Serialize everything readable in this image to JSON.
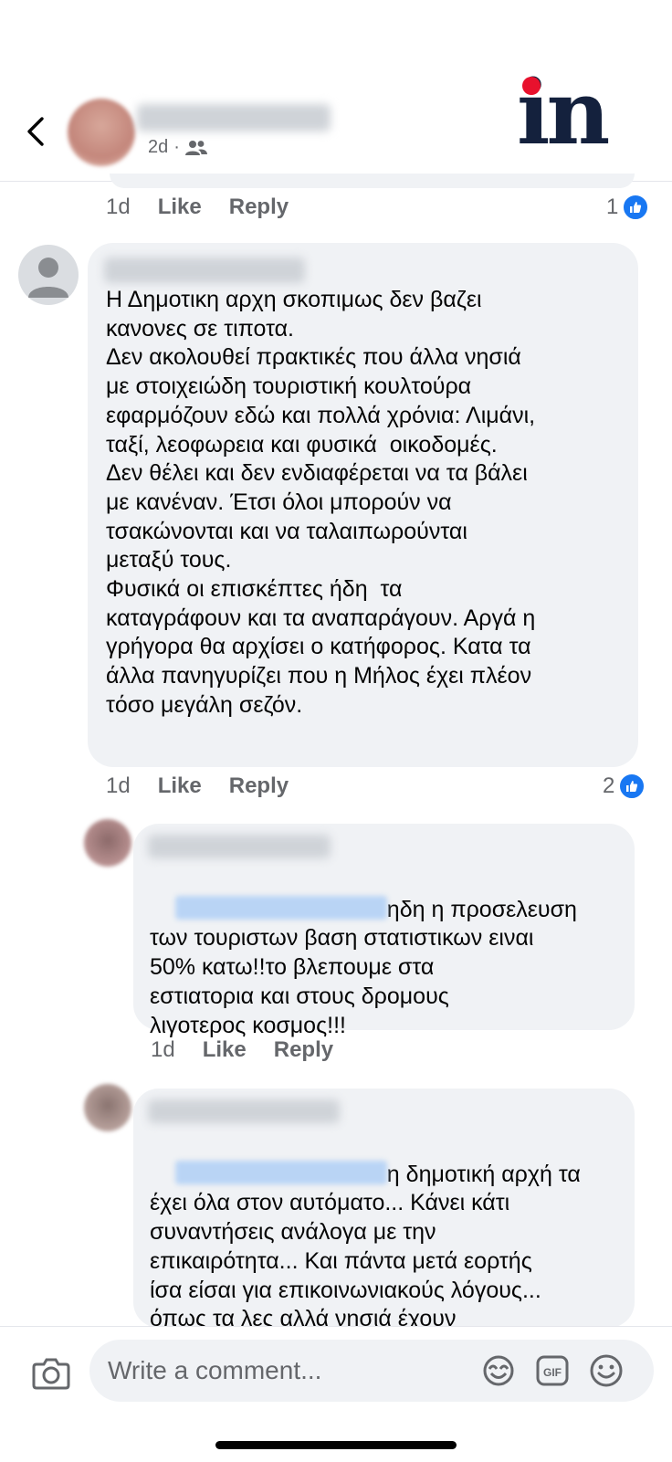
{
  "post_header": {
    "time": "2d",
    "audience_icon": "friends-icon",
    "logo_text": "in",
    "logo_colors": {
      "dot": "#e8112d",
      "letters": "#14213d"
    }
  },
  "prev_comment": {
    "time": "1d",
    "like": "Like",
    "reply": "Reply",
    "reaction_count": "1"
  },
  "comments": [
    {
      "text": "Η Δημοτικη αρχη σκοπιμως δεν βαζει\nκανονες σε τιποτα.\nΔεν ακολουθεί πρακτικές που άλλα νησιά\nμε στοιχειώδη τουριστική κουλτούρα\nεφαρμόζουν εδώ και πολλά χρόνια: Λιμάνι,\nταξί, λεοφωρεια και φυσικά  οικοδομές.\nΔεν θέλει και δεν ενδιαφέρεται να τα βάλει\nμε κανέναν. Έτσι όλοι μπορούν να\nτσακώνονται και να ταλαιπωρούνται\nμεταξύ τους.\nΦυσικά οι επισκέπτες ήδη  τα\nκαταγράφουν και τα αναπαράγουν. Αργά η\nγρήγορα θα αρχίσει ο κατήφορος. Κατα τα\nάλλα πανηγυρίζει που η Μήλος έχει πλέον\nτόσο μεγάλη σεζόν.",
      "time": "1d",
      "like": "Like",
      "reply": "Reply",
      "reaction_count": "2"
    },
    {
      "text_first": "ηδη η προσελευση",
      "text_rest": "των τουριστων βαση στατιστικων ειναι\n50% κατω!!το βλεπουμε στα\nεστιατορια και στους δρομους\nλιγοτερος κοσμος!!!",
      "time": "1d",
      "like": "Like",
      "reply": "Reply"
    },
    {
      "text_first": "η δημοτική αρχή τα",
      "text_rest": "έχει όλα στον αυτόματο... Κάνει κάτι\nσυναντήσεις ανάλογα με την\nεπικαιρότητα... Και πάντα μετά εορτής\nίσα είσαι για επικοινωνιακούς λόγους...\nόπως τα λες αλλά νησιά έχουν"
    }
  ],
  "composer": {
    "placeholder": "Write a comment..."
  },
  "colors": {
    "bubble": "#f0f2f5",
    "like_blue": "#1877f2",
    "mention": "#b9d4f5",
    "muted_text": "#65676b"
  }
}
